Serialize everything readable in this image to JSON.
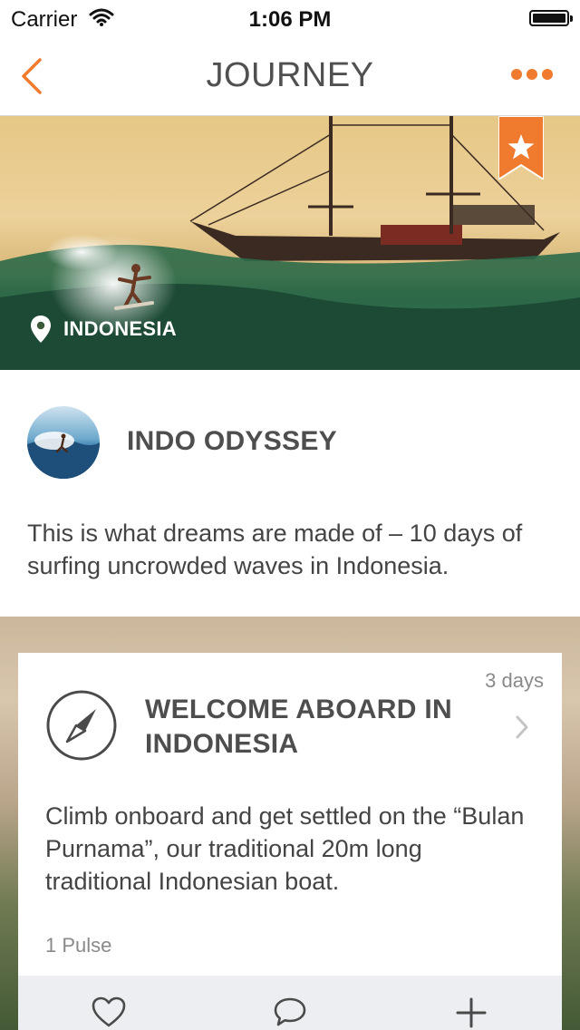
{
  "status_bar": {
    "carrier": "Carrier",
    "time": "1:06 PM"
  },
  "nav": {
    "title": "JOURNEY",
    "accent_color": "#f07a2e"
  },
  "hero": {
    "location": "INDONESIA"
  },
  "journey": {
    "name": "INDO ODYSSEY",
    "description": "This is what dreams are made of – 10 days of surfing uncrowded waves in Indonesia."
  },
  "stage_card": {
    "duration": "3 days",
    "title": "WELCOME ABOARD IN INDONESIA",
    "description": "Climb onboard and get settled on the “Bulan Purnama”, our traditional 20m long traditional Indonesian boat.",
    "pulse": "1 Pulse",
    "actions": [
      "heart-icon",
      "comment-icon",
      "plus-icon"
    ]
  }
}
